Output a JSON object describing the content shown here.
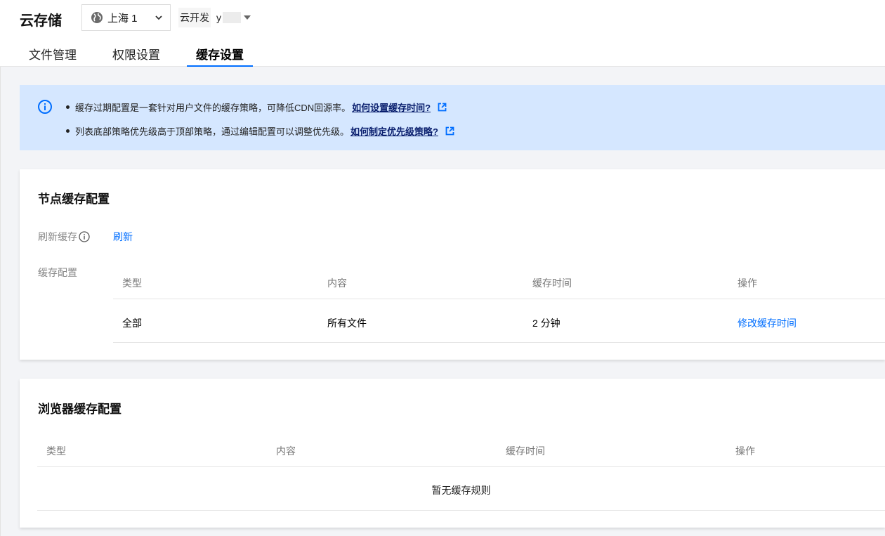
{
  "header": {
    "app_title": "云存储",
    "region": "上海 1",
    "env_name": "云开发",
    "env_id": "y"
  },
  "tabs": [
    {
      "label": "文件管理",
      "active": false
    },
    {
      "label": "权限设置",
      "active": false
    },
    {
      "label": "缓存设置",
      "active": true
    }
  ],
  "notice": {
    "line1_text": "缓存过期配置是一套针对用户文件的缓存策略，可降低CDN回源率。",
    "line1_link": "如何设置缓存时间?",
    "line2_text": "列表底部策略优先级高于顶部策略，通过编辑配置可以调整优先级。",
    "line2_link": "如何制定优先级策略?"
  },
  "node_cache": {
    "title": "节点缓存配置",
    "refresh_label": "刷新缓存",
    "refresh_action": "刷新",
    "config_label": "缓存配置",
    "columns": [
      "类型",
      "内容",
      "缓存时间",
      "操作"
    ],
    "rows": [
      {
        "type": "全部",
        "content": "所有文件",
        "duration": "2 分钟",
        "action": "修改缓存时间"
      }
    ]
  },
  "browser_cache": {
    "title": "浏览器缓存配置",
    "columns": [
      "类型",
      "内容",
      "缓存时间",
      "操作"
    ],
    "empty_text": "暂无缓存规则"
  },
  "colors": {
    "accent": "#006eff",
    "notice_bg": "#d5e7ff",
    "link_dark": "#0a1f6e"
  },
  "icons": {
    "region": "globe-icon",
    "notice": "info-circle-icon",
    "external": "external-link-icon",
    "help": "question-circle-icon"
  }
}
